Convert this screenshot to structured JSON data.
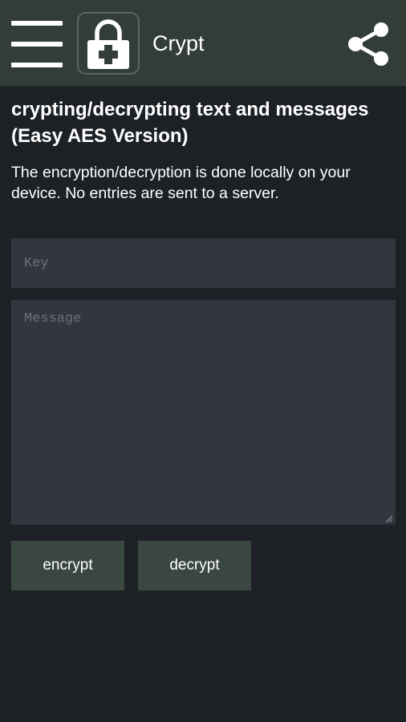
{
  "appbar": {
    "title": "Crypt",
    "menu_icon": "hamburger-menu-icon",
    "logo_icon": "lock-plus-icon",
    "share_icon": "share-icon",
    "background_color": "#333d37"
  },
  "main": {
    "heading": "crypting/decrypting text and messages (Easy AES Version)",
    "description": "The encryption/decryption is done locally on your device. No entries are sent to a server.",
    "key_field": {
      "value": "",
      "placeholder": "Key"
    },
    "message_field": {
      "value": "",
      "placeholder": "Message"
    },
    "encrypt_label": "encrypt",
    "decrypt_label": "decrypt"
  },
  "colors": {
    "page_background": "#1d2125",
    "field_background": "#31363f",
    "button_background": "#3a4640"
  }
}
